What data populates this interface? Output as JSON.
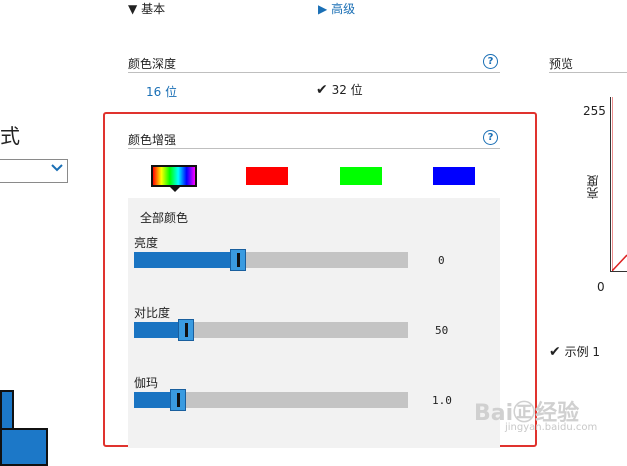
{
  "tabs": {
    "basic": "基本",
    "advanced": "高级",
    "basic_arrow": "▼",
    "advanced_arrow": "▶"
  },
  "color_depth": {
    "title": "颜色深度",
    "options": [
      {
        "label": "16 位",
        "selected": false
      },
      {
        "label": "32 位",
        "selected": true
      }
    ]
  },
  "preview": {
    "title": "预览",
    "y_max": "255",
    "y_min": "0",
    "axis_label": "亮度",
    "sample_label": "示例 1"
  },
  "left_fragment": {
    "text": "式"
  },
  "color_enhancement": {
    "title": "颜色增强",
    "swatches": [
      {
        "name": "all-colors",
        "color": "gradient"
      },
      {
        "name": "red",
        "color": "#ff0000"
      },
      {
        "name": "green",
        "color": "#00ff00"
      },
      {
        "name": "blue",
        "color": "#0000ff"
      }
    ],
    "channel_label": "全部颜色",
    "sliders": [
      {
        "label": "亮度",
        "value": "0",
        "level": 0.38
      },
      {
        "label": "对比度",
        "value": "50",
        "level": 0.19
      },
      {
        "label": "伽玛",
        "value": "1.0",
        "level": 0.16
      }
    ]
  },
  "help_glyph": "?",
  "check_glyph": "✔",
  "watermark": {
    "line1": "Bai㊣经验",
    "line2": "jingyan.baidu.com"
  }
}
